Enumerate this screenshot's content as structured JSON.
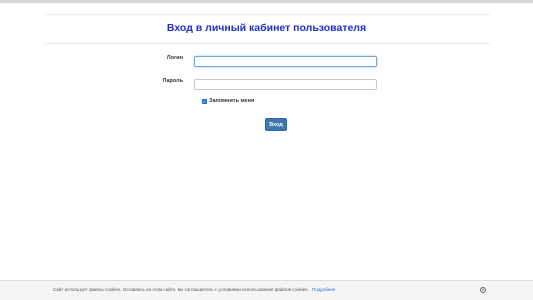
{
  "page": {
    "title": "Вход в личный кабинет пользователя"
  },
  "form": {
    "login_label": "Логин",
    "login_value": "",
    "password_label": "Пароль",
    "password_value": "",
    "remember_label": "Запомнить меня",
    "remember_checked": true,
    "submit_label": "Вход"
  },
  "cookie": {
    "text": "Сайт использует файлы cookies. Оставаясь на этом сайте, вы соглашаетесь с условиями использования файлов cookies.",
    "link_text": "Подробнее",
    "close_icon": "close-circle-icon"
  },
  "colors": {
    "title": "#1f2fc8",
    "button": "#3b78b4",
    "link": "#2a6fc1"
  }
}
